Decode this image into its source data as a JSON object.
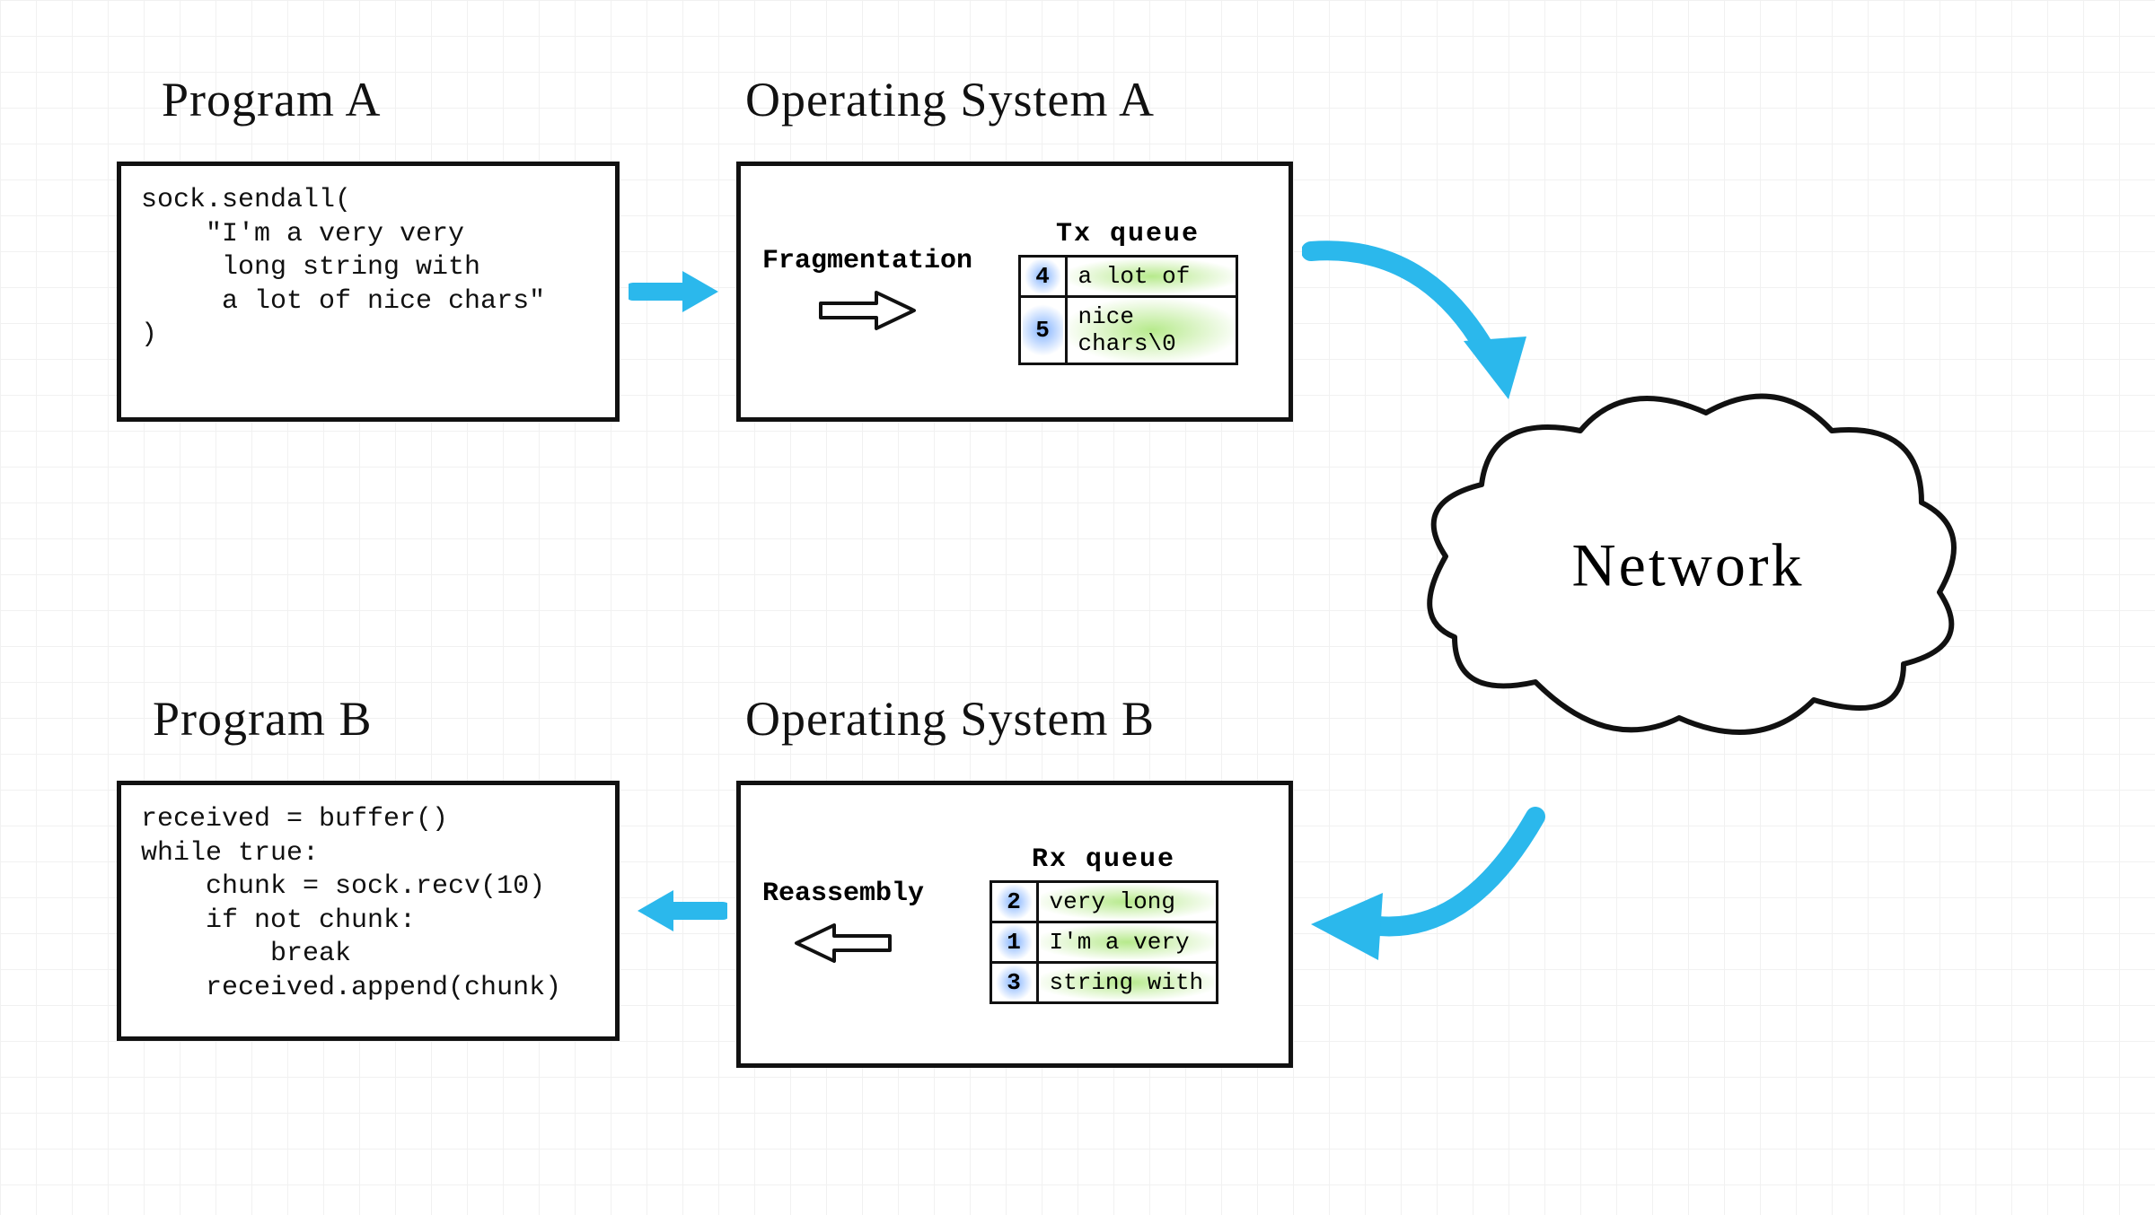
{
  "titles": {
    "program_a": "Program A",
    "os_a": "Operating System A",
    "program_b": "Program B",
    "os_b": "Operating System B"
  },
  "program_a_code": "sock.sendall(\n    \"I'm a very very\n     long string with\n     a lot of nice chars\"\n)",
  "program_b_code": "received = buffer()\nwhile true:\n    chunk = sock.recv(10)\n    if not chunk:\n        break\n    received.append(chunk)",
  "os_a": {
    "label": "Fragmentation",
    "queue_title": "Tx queue",
    "rows": [
      {
        "seq": "4",
        "payload": "a lot of"
      },
      {
        "seq": "5",
        "payload": "nice\nchars\\0"
      }
    ]
  },
  "os_b": {
    "label": "Reassembly",
    "queue_title": "Rx queue",
    "rows": [
      {
        "seq": "2",
        "payload": "very long"
      },
      {
        "seq": "1",
        "payload": "I'm a very"
      },
      {
        "seq": "3",
        "payload": "string with"
      }
    ]
  },
  "cloud_label": "Network"
}
